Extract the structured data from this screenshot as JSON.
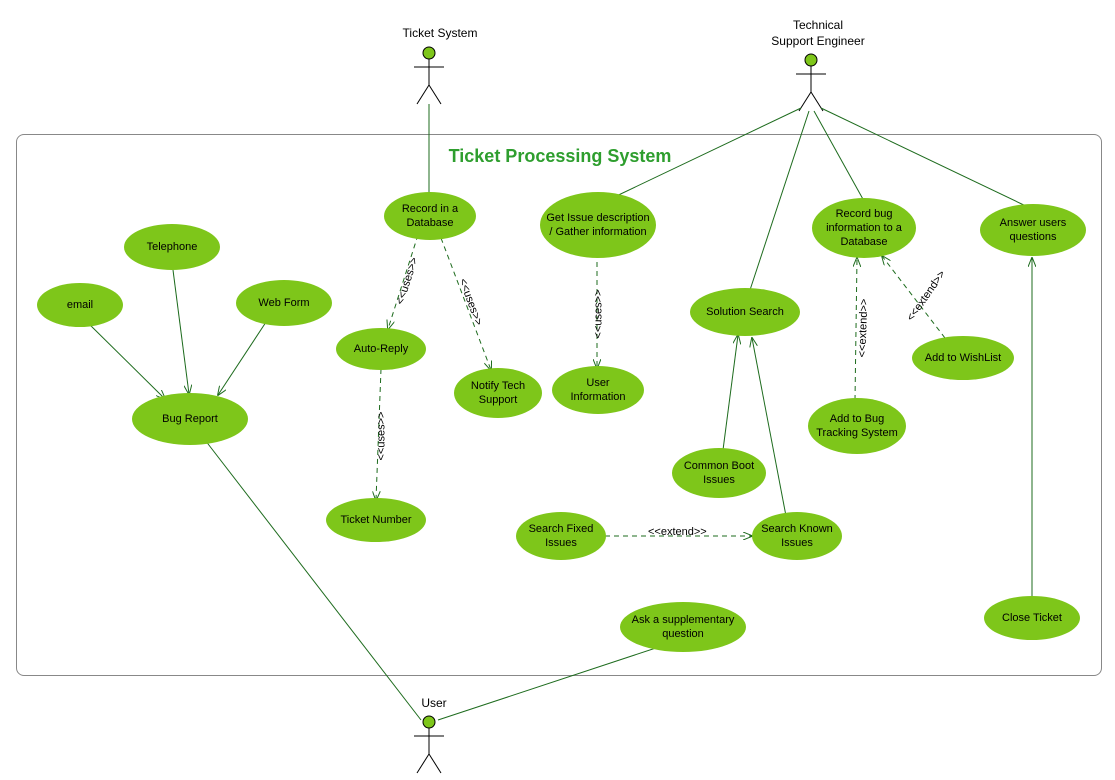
{
  "title": "Ticket Processing System",
  "actors": {
    "ticket_system": "Ticket System",
    "support_engineer_line1": "Technical",
    "support_engineer_line2": "Support Engineer",
    "user": "User"
  },
  "use_cases": {
    "email": "email",
    "telephone": "Telephone",
    "web_form": "Web Form",
    "bug_report": "Bug Report",
    "record_db": "Record in a Database",
    "auto_reply": "Auto-Reply",
    "notify_tech": "Notify Tech Support",
    "ticket_number": "Ticket Number",
    "get_issue": "Get Issue description / Gather information",
    "user_info": "User Information",
    "solution_search": "Solution Search",
    "common_boot": "Common Boot Issues",
    "search_fixed": "Search Fixed Issues",
    "search_known": "Search Known Issues",
    "record_bug": "Record bug information to a Database",
    "add_bug_tracking": "Add to Bug Tracking System",
    "add_wishlist": "Add to WishList",
    "answer_users": "Answer users questions",
    "close_ticket": "Close Ticket",
    "ask_supplementary": "Ask a supplementary question"
  },
  "relationships": {
    "uses": "<<uses>>",
    "extend": "<<extend>>"
  }
}
